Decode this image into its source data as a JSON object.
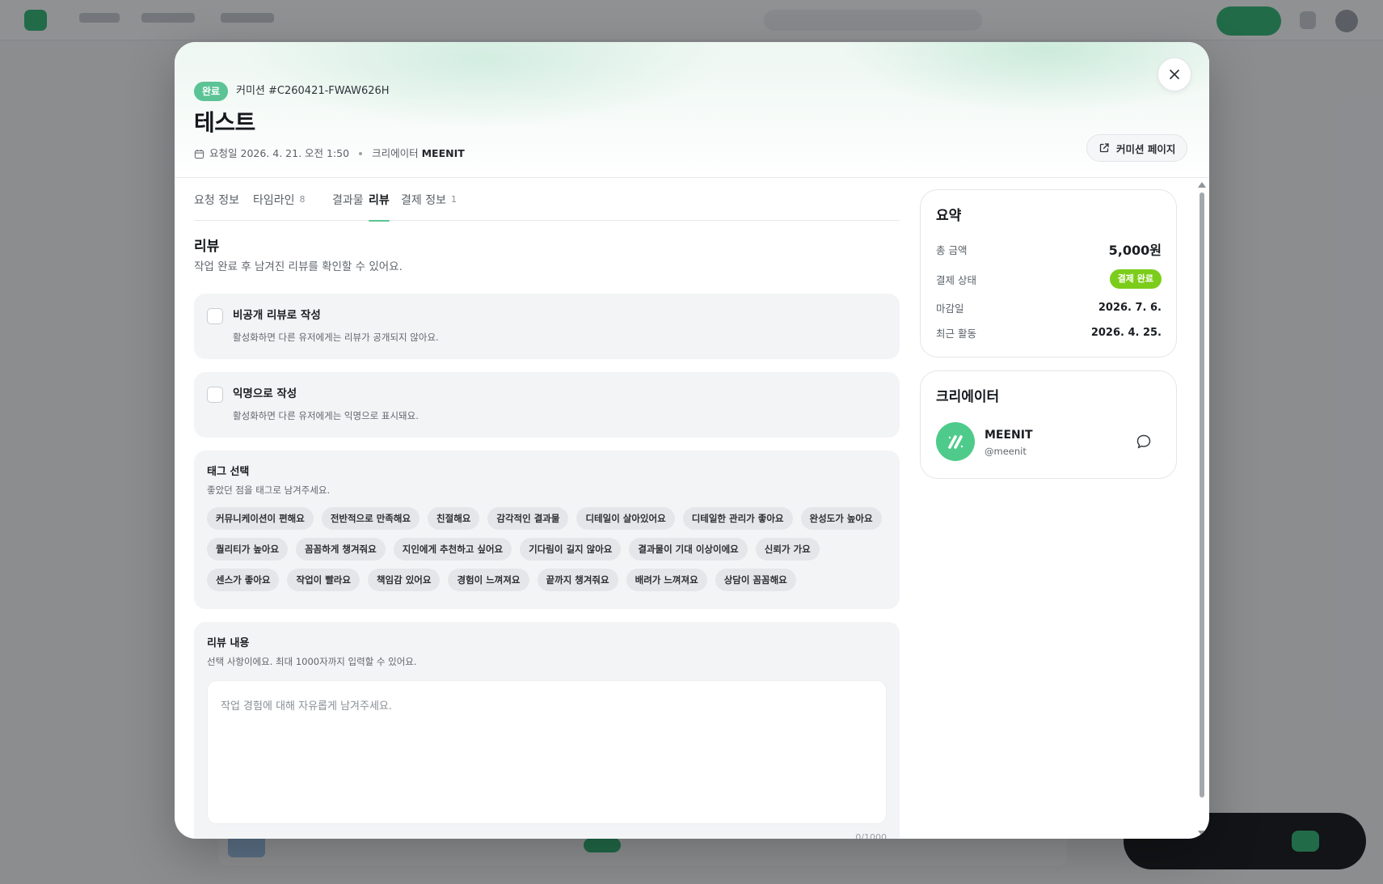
{
  "modal": {
    "status": "완료",
    "commission_id": "커미션 #C260421-FWAW626H",
    "title": "테스트",
    "requested_label": "요청일",
    "requested_date": "2026. 4. 21. 오전 1:50",
    "creator_label": "크리에이터",
    "creator_name": "MEENIT",
    "commission_page_label": "커미션 페이지"
  },
  "tabs": [
    {
      "label": "요청 정보",
      "count": ""
    },
    {
      "label": "타임라인",
      "count": "8"
    },
    {
      "label": "결과물",
      "count": ""
    },
    {
      "label": "리뷰",
      "count": ""
    },
    {
      "label": "결제 정보",
      "count": "1"
    }
  ],
  "review": {
    "title": "리뷰",
    "description": "작업 완료 후 남겨진 리뷰를 확인할 수 있어요.",
    "private_option": {
      "title": "비공개 리뷰로 작성",
      "description": "활성화하면 다른 유저에게는 리뷰가 공개되지 않아요."
    },
    "anonymous_option": {
      "title": "익명으로 작성",
      "description": "활성화하면 다른 유저에게는 익명으로 표시돼요."
    },
    "tags": {
      "title": "태그 선택",
      "description": "좋았던 점을 태그로 남겨주세요.",
      "items": [
        "커뮤니케이션이 편해요",
        "전반적으로 만족해요",
        "친절해요",
        "감각적인 결과물",
        "디테일이 살아있어요",
        "디테일한 관리가 좋아요",
        "완성도가 높아요",
        "퀄리티가 높아요",
        "꼼꼼하게 챙겨줘요",
        "지인에게 추천하고 싶어요",
        "기다림이 길지 않아요",
        "결과물이 기대 이상이에요",
        "신뢰가 가요",
        "센스가 좋아요",
        "작업이 빨라요",
        "책임감 있어요",
        "경험이 느껴져요",
        "끝까지 챙겨줘요",
        "배려가 느껴져요",
        "상담이 꼼꼼해요"
      ]
    },
    "content": {
      "title": "리뷰 내용",
      "description": "선택 사항이에요. 최대 1000자까지 입력할 수 있어요.",
      "placeholder": "작업 경험에 대해 자유롭게 남겨주세요.",
      "char_count": "0/1000"
    }
  },
  "summary": {
    "title": "요약",
    "total_label": "총 금액",
    "total_value": "5,000원",
    "payment_status_label": "결제 상태",
    "payment_status_value": "결제 완료",
    "deadline_label": "마감일",
    "deadline_value": "2026. 7. 6.",
    "recent_label": "최근 활동",
    "recent_value": "2026. 4. 25."
  },
  "creator": {
    "title": "크리에이터",
    "name": "MEENIT",
    "handle": "@meenit"
  },
  "colors": {
    "accent": "#5bc395",
    "payment_badge": "#7ccd1b",
    "avatar": "#4ecb8a"
  },
  "icons": [
    "calendar-icon",
    "close-icon",
    "external-link-icon",
    "chat-bubble-icon",
    "meenit-logo"
  ]
}
